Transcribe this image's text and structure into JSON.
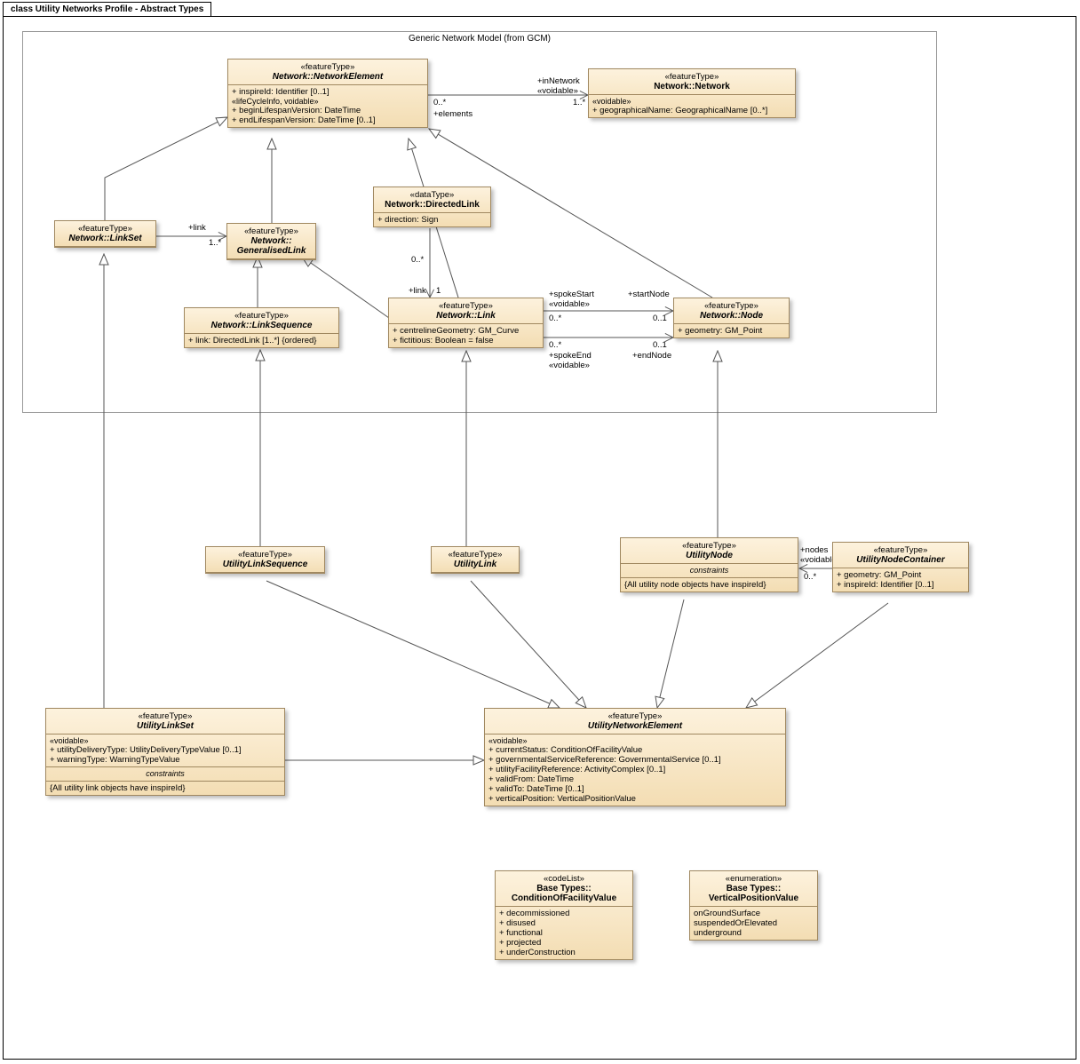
{
  "diagram": {
    "title": "class Utility Networks Profile - Abstract Types",
    "packageTitle": "Generic Network Model (from GCM)"
  },
  "classes": {
    "networkElement": {
      "stereo": "«featureType»",
      "name": "Network::NetworkElement",
      "a1": "+   inspireId: Identifier [0..1]",
      "sh": "«lifeCycleInfo, voidable»",
      "a2": "+   beginLifespanVersion: DateTime",
      "a3": "+   endLifespanVersion: DateTime [0..1]"
    },
    "network": {
      "stereo": "«featureType»",
      "name": "Network::Network",
      "sh": "«voidable»",
      "a1": "+   geographicalName: GeographicalName [0..*]"
    },
    "linkSet": {
      "stereo": "«featureType»",
      "name": "Network::LinkSet"
    },
    "generalisedLink": {
      "stereo": "«featureType»",
      "name": "Network::\nGeneralisedLink"
    },
    "directedLink": {
      "stereo": "«dataType»",
      "name": "Network::DirectedLink",
      "a1": "+   direction: Sign"
    },
    "linkSequence": {
      "stereo": "«featureType»",
      "name": "Network::LinkSequence",
      "a1": "+   link: DirectedLink [1..*] {ordered}"
    },
    "link": {
      "stereo": "«featureType»",
      "name": "Network::Link",
      "a1": "+   centrelineGeometry: GM_Curve",
      "a2": "+   fictitious: Boolean = false"
    },
    "node": {
      "stereo": "«featureType»",
      "name": "Network::Node",
      "a1": "+   geometry: GM_Point"
    },
    "utilityLinkSequence": {
      "stereo": "«featureType»",
      "name": "UtilityLinkSequence"
    },
    "utilityLink": {
      "stereo": "«featureType»",
      "name": "UtilityLink"
    },
    "utilityNode": {
      "stereo": "«featureType»",
      "name": "UtilityNode",
      "csh": "constraints",
      "c1": "{All utility node objects have inspireId}"
    },
    "utilityNodeContainer": {
      "stereo": "«featureType»",
      "name": "UtilityNodeContainer",
      "a1": "+   geometry: GM_Point",
      "a2": "+   inspireId: Identifier [0..1]"
    },
    "utilityLinkSet": {
      "stereo": "«featureType»",
      "name": "UtilityLinkSet",
      "sh": "«voidable»",
      "a1": "+   utilityDeliveryType: UtilityDeliveryTypeValue [0..1]",
      "a2": "+   warningType: WarningTypeValue",
      "csh": "constraints",
      "c1": "{All utility link objects have inspireId}"
    },
    "utilityNetworkElement": {
      "stereo": "«featureType»",
      "name": "UtilityNetworkElement",
      "sh": "«voidable»",
      "a1": "+   currentStatus: ConditionOfFacilityValue",
      "a2": "+   governmentalServiceReference: GovernmentalService [0..1]",
      "a3": "+   utilityFacilityReference: ActivityComplex [0..1]",
      "a4": "+   validFrom: DateTime",
      "a5": "+   validTo: DateTime [0..1]",
      "a6": "+   verticalPosition: VerticalPositionValue"
    },
    "conditionOfFacility": {
      "stereo": "«codeList»",
      "name": "Base Types::\nConditionOfFacilityValue",
      "a1": "+   decommissioned",
      "a2": "+   disused",
      "a3": "+   functional",
      "a4": "+   projected",
      "a5": "+   underConstruction"
    },
    "verticalPosition": {
      "stereo": "«enumeration»",
      "name": "Base Types::\nVerticalPositionValue",
      "a1": "   onGroundSurface",
      "a2": "   suspendedOrElevated",
      "a3": "   underground"
    }
  },
  "labels": {
    "inNetwork": "+inNetwork",
    "voidable": "«voidable»",
    "elements": "+elements",
    "m0s": "0..*",
    "m1s": "1..*",
    "m01": "0..1",
    "one": "1",
    "plink": "+link",
    "spokeStart": "+spokeStart",
    "spokeEnd": "+spokeEnd",
    "startNode": "+startNode",
    "endNode": "+endNode",
    "nodes": "+nodes"
  }
}
